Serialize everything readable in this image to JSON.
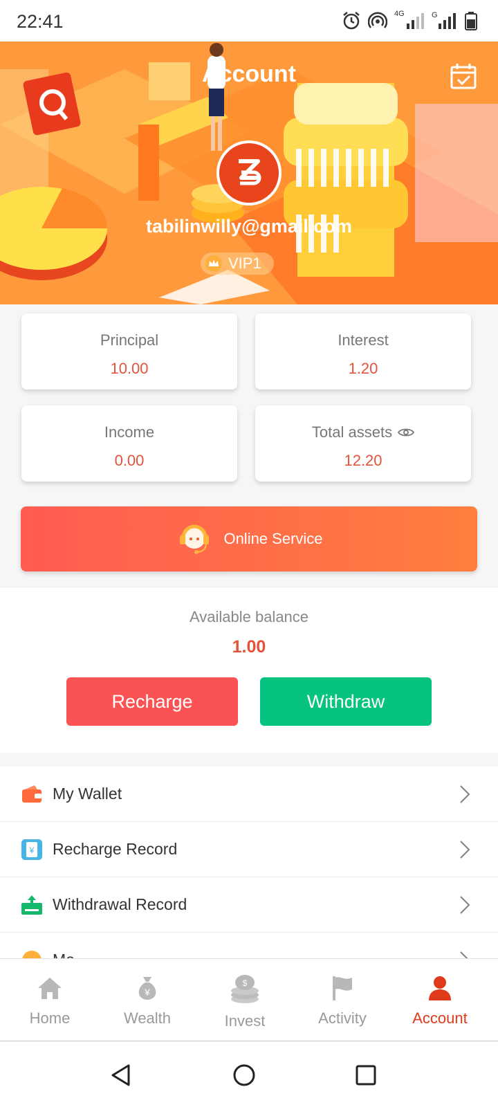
{
  "status_bar": {
    "time": "22:41",
    "network": "4G"
  },
  "header": {
    "title": "Account",
    "email": "tabilinwilly@gmail.com",
    "vip_level": "VIP1"
  },
  "stats": {
    "principal": {
      "label": "Principal",
      "value": "10.00"
    },
    "interest": {
      "label": "Interest",
      "value": "1.20"
    },
    "income": {
      "label": "Income",
      "value": "0.00"
    },
    "total_assets": {
      "label": "Total assets",
      "value": "12.20"
    }
  },
  "online_service": {
    "label": "Online Service"
  },
  "balance": {
    "label": "Available balance",
    "value": "1.00",
    "recharge_label": "Recharge",
    "withdraw_label": "Withdraw"
  },
  "menu": {
    "items": [
      {
        "label": "My Wallet",
        "icon": "wallet-icon"
      },
      {
        "label": "Recharge Record",
        "icon": "receipt-icon"
      },
      {
        "label": "Withdrawal Record",
        "icon": "withdraw-icon"
      },
      {
        "label": "Mo...",
        "icon": "coin-icon"
      }
    ]
  },
  "tabbar": {
    "items": [
      {
        "label": "Home",
        "icon": "home-icon"
      },
      {
        "label": "Wealth",
        "icon": "money-bag-icon"
      },
      {
        "label": "Invest",
        "icon": "coin-stack-icon"
      },
      {
        "label": "Activity",
        "icon": "flag-icon"
      },
      {
        "label": "Account",
        "icon": "person-icon"
      }
    ],
    "active": "Account"
  },
  "colors": {
    "accent": "#e5533b",
    "recharge": "#fb5353",
    "withdraw": "#06c47f",
    "active_tab": "#e03a1c"
  }
}
